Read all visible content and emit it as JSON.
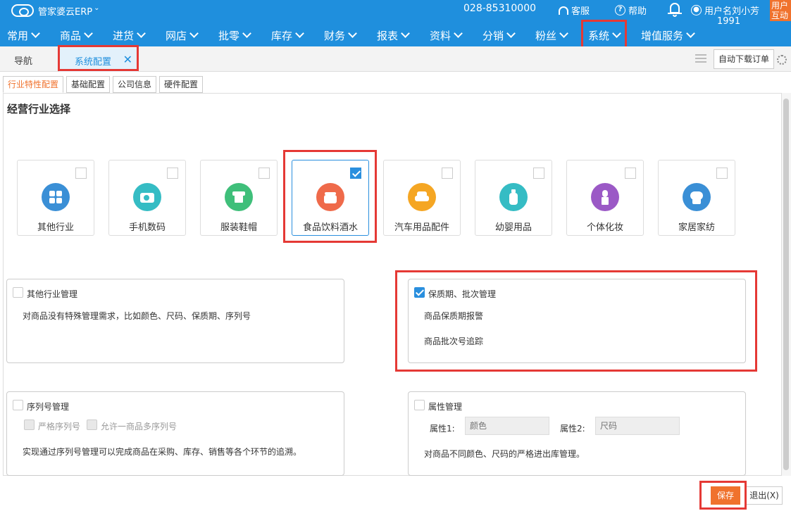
{
  "app": {
    "logo_text": "管家婆云ERP",
    "phone": "028-85310000",
    "support_label": "客服",
    "help_label": "帮助",
    "username": "用户名刘小芳",
    "user_id": "1991",
    "interact_badge": "用户互动"
  },
  "nav": {
    "items": [
      "常用",
      "商品",
      "进货",
      "网店",
      "批零",
      "库存",
      "财务",
      "报表",
      "资料",
      "分销",
      "粉丝",
      "系统",
      "增值服务"
    ]
  },
  "tabs": {
    "nav_label": "导航",
    "active_label": "系统配置",
    "close_symbol": "✕",
    "auto_download_label": "自动下载订单"
  },
  "subtabs": [
    "行业特性配置",
    "基础配置",
    "公司信息",
    "硬件配置"
  ],
  "section": {
    "title": "经营行业选择"
  },
  "industries": [
    {
      "label": "其他行业",
      "color": "#3a8fd6",
      "icon": "grid-icon",
      "checked": false
    },
    {
      "label": "手机数码",
      "color": "#35bcc4",
      "icon": "camera-icon",
      "checked": false
    },
    {
      "label": "服装鞋帽",
      "color": "#3fbf7a",
      "icon": "shirt-icon",
      "checked": false
    },
    {
      "label": "食品饮料酒水",
      "color": "#ef6a4a",
      "icon": "food-icon",
      "checked": true
    },
    {
      "label": "汽车用品配件",
      "color": "#f5a623",
      "icon": "car-icon",
      "checked": false
    },
    {
      "label": "幼婴用品",
      "color": "#35bcc4",
      "icon": "bottle-icon",
      "checked": false
    },
    {
      "label": "个体化妆",
      "color": "#9b59c6",
      "icon": "lipstick-icon",
      "checked": false
    },
    {
      "label": "家居家纺",
      "color": "#3a8fd6",
      "icon": "home-textile-icon",
      "checked": false
    }
  ],
  "panels": {
    "other": {
      "title": "其他行业管理",
      "desc": "对商品没有特殊管理需求，比如颜色、尺码、保质期、序列号",
      "checked": false
    },
    "shelf": {
      "title": "保质期、批次管理",
      "line1": "商品保质期报警",
      "line2": "商品批次号追踪",
      "checked": true
    },
    "serial": {
      "title": "序列号管理",
      "opt1": "严格序列号",
      "opt2": "允许一商品多序列号",
      "desc": "实现通过序列号管理可以完成商品在采购、库存、销售等各个环节的追溯。",
      "checked": false
    },
    "attr": {
      "title": "属性管理",
      "attr1_label": "属性1:",
      "attr1_value": "颜色",
      "attr2_label": "属性2:",
      "attr2_value": "尺码",
      "desc": "对商品不同颜色、尺码的严格进出库管理。",
      "checked": false
    }
  },
  "actions": {
    "save_label": "保存",
    "exit_label": "退出(X)"
  },
  "colors": {
    "brand": "#1f8fdd",
    "accent": "#f0722d",
    "highlight": "#e53935"
  }
}
